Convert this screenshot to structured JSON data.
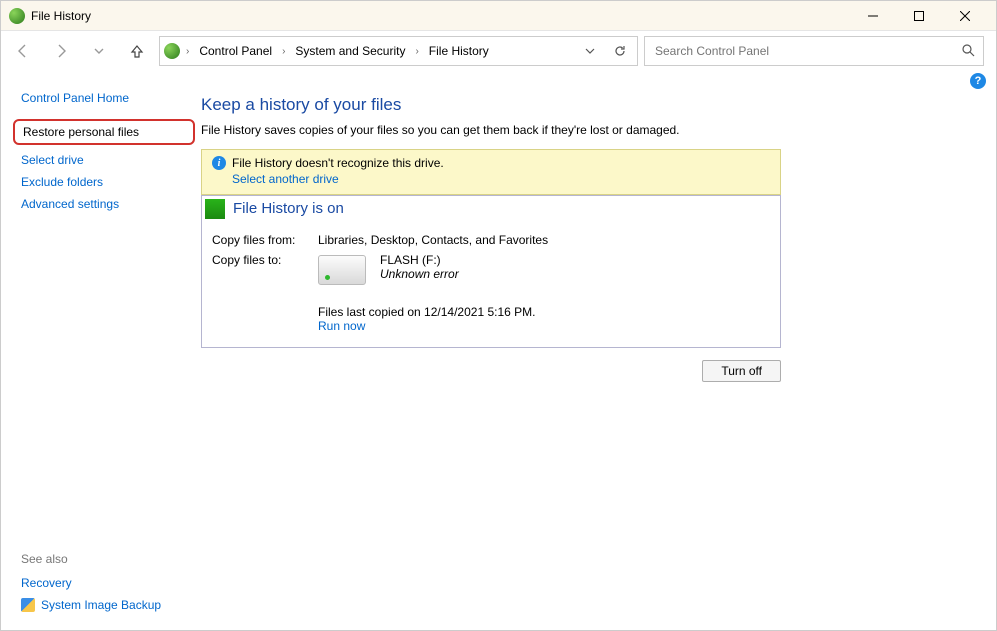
{
  "window": {
    "title": "File History"
  },
  "breadcrumb": {
    "items": [
      "Control Panel",
      "System and Security",
      "File History"
    ]
  },
  "search": {
    "placeholder": "Search Control Panel"
  },
  "sidebar": {
    "home": "Control Panel Home",
    "items": [
      "Restore personal files",
      "Select drive",
      "Exclude folders",
      "Advanced settings"
    ]
  },
  "see_also": {
    "header": "See also",
    "items": [
      "Recovery",
      "System Image Backup"
    ]
  },
  "main": {
    "title": "Keep a history of your files",
    "subtitle": "File History saves copies of your files so you can get them back if they're lost or damaged."
  },
  "warning": {
    "text": "File History doesn't recognize this drive.",
    "link": "Select another drive"
  },
  "status": {
    "title": "File History is on",
    "copy_from_label": "Copy files from:",
    "copy_from_value": "Libraries, Desktop, Contacts, and Favorites",
    "copy_to_label": "Copy files to:",
    "drive_name": "FLASH (F:)",
    "drive_status": "Unknown error",
    "last_copied": "Files last copied on 12/14/2021 5:16 PM.",
    "run_now": "Run now"
  },
  "buttons": {
    "turn_off": "Turn off"
  }
}
